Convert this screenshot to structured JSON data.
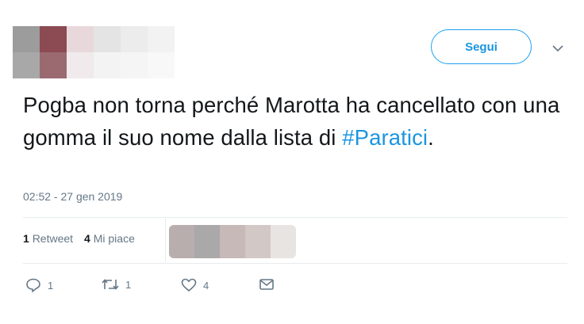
{
  "header": {
    "follow_label": "Segui"
  },
  "tweet": {
    "text_before": "Pogba non torna perché Marotta ha cancellato con una gomma il suo nome dalla lista di ",
    "hashtag": "#Paratici",
    "text_after": ".",
    "timestamp": "02:52 - 27 gen 2019"
  },
  "stats": {
    "retweets_count": "1",
    "retweets_label": "Retweet",
    "likes_count": "4",
    "likes_label": "Mi piace"
  },
  "actions": {
    "reply_count": "1",
    "retweet_count": "1",
    "like_count": "4"
  },
  "colors": {
    "accent": "#1da1f2",
    "link": "#1b95e0",
    "muted": "#657786",
    "divider": "#e6ecf0"
  },
  "icons": [
    "chevron-down-icon",
    "reply-icon",
    "retweet-icon",
    "heart-icon",
    "envelope-icon"
  ]
}
